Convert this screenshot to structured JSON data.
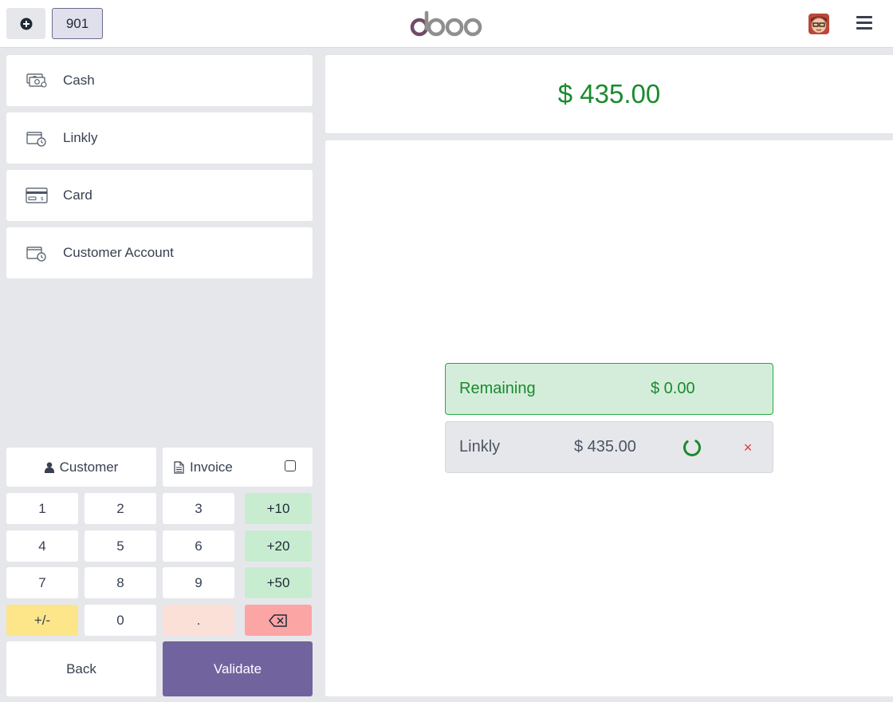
{
  "header": {
    "order_number": "901",
    "logo_text": "odoo"
  },
  "payment_methods": [
    {
      "label": "Cash",
      "icon": "cash-icon"
    },
    {
      "label": "Linkly",
      "icon": "wallet-clock-icon"
    },
    {
      "label": "Card",
      "icon": "credit-card-icon"
    },
    {
      "label": "Customer Account",
      "icon": "wallet-clock-icon"
    }
  ],
  "controls": {
    "customer_label": "Customer",
    "invoice_label": "Invoice"
  },
  "numpad": {
    "keys": [
      "1",
      "2",
      "3",
      "+10",
      "4",
      "5",
      "6",
      "+20",
      "7",
      "8",
      "9",
      "+50",
      "+/-",
      "0",
      ".",
      "⌫"
    ]
  },
  "actions": {
    "back_label": "Back",
    "validate_label": "Validate"
  },
  "summary": {
    "total": "$ 435.00",
    "remaining_label": "Remaining",
    "remaining_value": "$ 0.00"
  },
  "paymentlines": [
    {
      "method": "Linkly",
      "amount": "$ 435.00",
      "delete_symbol": "×"
    }
  ],
  "colors": {
    "validate": "#71639e",
    "total_text": "#1a8a2f",
    "remaining_bg": "#d4edda",
    "quick_add_keys": "#c8ecd0",
    "sign_key": "#fde68a",
    "decimal_key": "#fbe0d8",
    "backspace_key": "#fca5a5",
    "delete_line": "#dc3545"
  }
}
